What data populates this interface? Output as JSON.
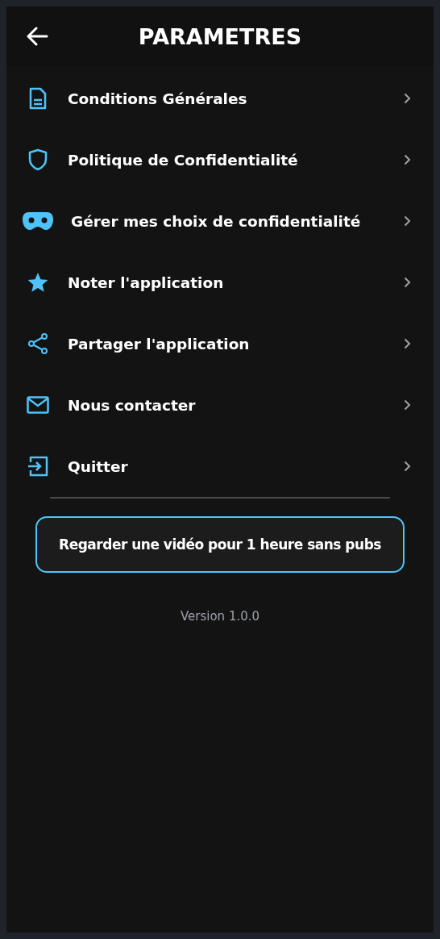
{
  "header": {
    "title": "PARAMETRES"
  },
  "menu": [
    {
      "kind": "document",
      "label": "Conditions Générales"
    },
    {
      "kind": "shield",
      "label": "Politique de Confidentialité"
    },
    {
      "kind": "mask",
      "label": "Gérer mes choix de confidentialité"
    },
    {
      "kind": "star",
      "label": "Noter l'application"
    },
    {
      "kind": "share",
      "label": "Partager l'application"
    },
    {
      "kind": "mail",
      "label": "Nous contacter"
    },
    {
      "kind": "exit",
      "label": "Quitter"
    }
  ],
  "ad_button": {
    "label": "Regarder une vidéo pour 1 heure sans pubs"
  },
  "version": "Version 1.0.0"
}
